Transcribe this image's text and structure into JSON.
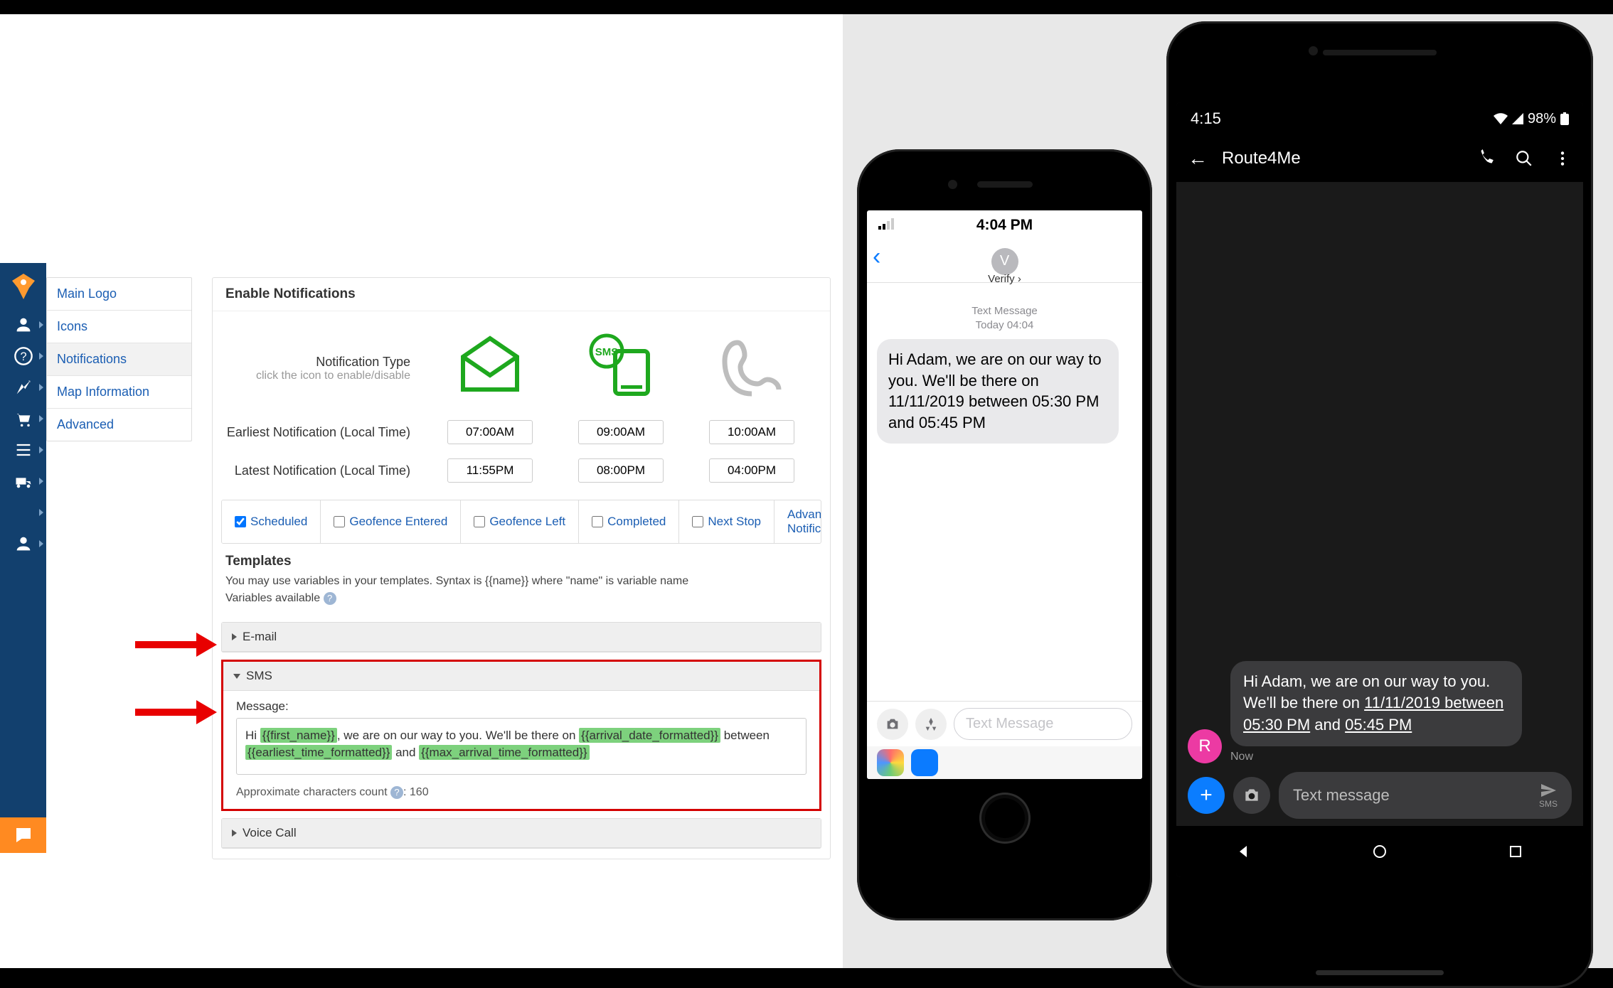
{
  "colors": {
    "brand_green": "#1ea81e",
    "brand_blue": "#12406e",
    "link": "#1b5eb3",
    "red": "#d40000"
  },
  "sidenav": {
    "items": [
      {
        "label": "Main Logo"
      },
      {
        "label": "Icons"
      },
      {
        "label": "Notifications",
        "active": true
      },
      {
        "label": "Map Information"
      },
      {
        "label": "Advanced"
      }
    ]
  },
  "panel": {
    "title": "Enable Notifications",
    "type_label": "Notification Type",
    "type_sub": "click the icon to enable/disable",
    "earliest_label": "Earliest Notification (Local Time)",
    "latest_label": "Latest Notification (Local Time)",
    "cols": {
      "email": {
        "earliest": "07:00AM",
        "latest": "11:55PM"
      },
      "sms": {
        "earliest": "09:00AM",
        "latest": "08:00PM"
      },
      "phone": {
        "earliest": "10:00AM",
        "latest": "04:00PM"
      }
    }
  },
  "tabs": {
    "scheduled": "Scheduled",
    "geofence_entered": "Geofence Entered",
    "geofence_left": "Geofence Left",
    "completed": "Completed",
    "next_stop": "Next Stop",
    "advance": "Advance Notification"
  },
  "templates": {
    "heading": "Templates",
    "hint": "You may use variables in your templates. Syntax is {{name}} where \"name\" is variable name",
    "vars_label": "Variables available",
    "email_label": "E-mail",
    "sms_label": "SMS",
    "voice_label": "Voice Call",
    "msg_label": "Message:",
    "msg_prefix": "Hi ",
    "msg_var1": "{{first_name}}",
    "msg_mid1": ", we are on our way to you. We'll be there on ",
    "msg_var2": "{{arrival_date_formatted}}",
    "msg_mid2": " between ",
    "msg_var3": "{{earliest_time_formatted}}",
    "msg_mid3": " and ",
    "msg_var4": "{{max_arrival_time_formatted}}",
    "charcount_label": "Approximate characters count",
    "charcount_value": "160"
  },
  "iphone": {
    "clock": "4:04 PM",
    "contact_initial": "V",
    "contact_name": "Verify",
    "meta_line1": "Text Message",
    "meta_line2": "Today 04:04",
    "bubble": "Hi Adam, we are on our way to you. We'll be there on 11/11/2019 between 05:30 PM and 05:45 PM",
    "placeholder": "Text Message"
  },
  "android": {
    "clock": "4:15",
    "battery": "98%",
    "title": "Route4Me",
    "avatar_letter": "R",
    "bubble_pre": "Hi Adam, we are on our way to you. We'll be there on ",
    "bubble_link1": "11/11/2019 between 05:30 PM",
    "bubble_mid": " and ",
    "bubble_link2": "05:45 PM",
    "time": "Now",
    "placeholder": "Text message",
    "send_lbl": "SMS"
  }
}
